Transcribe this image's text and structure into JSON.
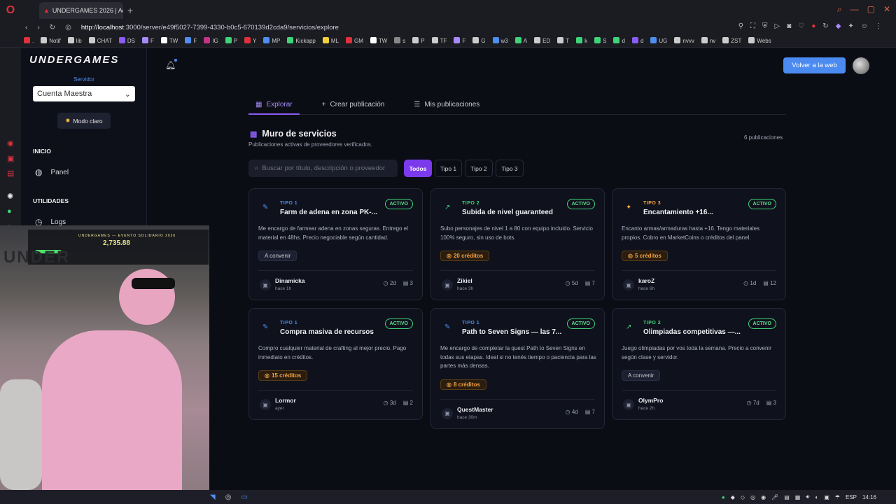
{
  "browser": {
    "tab_title": "UNDERGAMES 2026 | Acc",
    "url_host": "http://localhost",
    "url_rest": ":3000/server/e49f5027-7399-4330-b0c5-670139d2cda9/servicios/explore",
    "bookmarks": [
      ".",
      "Notif",
      "lib",
      "CHAT",
      "DS",
      "F",
      "TW",
      "F",
      "IG",
      "P",
      "Y",
      "MP",
      "Kickapp",
      "ML",
      "GM",
      "TW",
      "s",
      "P",
      "TF",
      "F",
      "G",
      "w3",
      "A",
      "ED",
      "T",
      "k",
      "S",
      "d",
      "d",
      "UG",
      "nvvv",
      "nv",
      "ZST",
      "Webs"
    ]
  },
  "sidebar": {
    "logo": "UNDERGAMES",
    "server_label": "Servidor",
    "server_value": "Cuenta Maestra",
    "theme_button": "Modo claro",
    "section_inicio": "INICIO",
    "item_panel": "Panel",
    "section_utilidades": "UTILIDADES",
    "item_logs": "Logs"
  },
  "header": {
    "back_button": "Volver a la web"
  },
  "tabs": {
    "explore": "Explorar",
    "create": "Crear publicación",
    "mine": "Mis publicaciones"
  },
  "wall": {
    "title": "Muro de servicios",
    "subtitle": "Publicaciones activas de proveedores verificados.",
    "count": "6 publicaciones",
    "search_placeholder": "Buscar por título, descripción o proveedor",
    "filters": [
      "Todos",
      "Tipo 1",
      "Tipo 2",
      "Tipo 3"
    ]
  },
  "cards": [
    {
      "tipo": "TIPO 1",
      "title": "Farm de adena en zona PK-...",
      "status": "ACTIVO",
      "desc": "Me encargo de farmear adena en zonas seguras. Entrego el material en 48hs. Precio negociable según cantidad.",
      "price": "A convenir",
      "user": "Dinamicka",
      "when": "hace 1h",
      "age": "2d",
      "comments": "3"
    },
    {
      "tipo": "TIPO 2",
      "title": "Subida de nivel guaranteed",
      "status": "ACTIVO",
      "desc": "Subo personajes de nivel 1 a 80 con equipo incluido. Servicio 100% seguro, sin uso de bots.",
      "price": "20 créditos",
      "user": "Zikiel",
      "when": "hace 3h",
      "age": "5d",
      "comments": "7"
    },
    {
      "tipo": "TIPO 3",
      "title": "Encantamiento +16...",
      "status": "ACTIVO",
      "desc": "Encanto armas/armaduras hasta +16. Tengo materiales propios. Cobro en MarketCoins o créditos del panel.",
      "price": "5 créditos",
      "user": "karoZ",
      "when": "hace 6h",
      "age": "1d",
      "comments": "12"
    },
    {
      "tipo": "TIPO 1",
      "title": "Compra masiva de recursos",
      "status": "ACTIVO",
      "desc": "Compro cualquier material de crafting al mejor precio. Pago inmediato en créditos.",
      "price": "15 créditos",
      "user": "Lormor",
      "when": "ayer",
      "age": "3d",
      "comments": "2"
    },
    {
      "tipo": "TIPO 1",
      "title": "Path to Seven Signs — las 7...",
      "status": "ACTIVO",
      "desc": "Me encargo de completar la quest Path to Seven Signs en todas sus etapas. Ideal si no tenés tiempo o paciencia para las partes más densas.",
      "price": "8 créditos",
      "user": "QuestMaster",
      "when": "hace 30m",
      "age": "4d",
      "comments": "7"
    },
    {
      "tipo": "TIPO 2",
      "title": "Olimpiadas competitivas —...",
      "status": "ACTIVO",
      "desc": "Juego olimpiadas por vos toda la semana. Precio a convenir según clase y servidor.",
      "price": "A convenir",
      "user": "OlymPro",
      "when": "hace 2h",
      "age": "7d",
      "comments": "3"
    }
  ],
  "webcam": {
    "banner_title": "UNDERGAMES — EVENTO SOLIDARIO 2026",
    "banner_amount": "2,735.88",
    "logo_text": "UNDER"
  },
  "taskbar": {
    "lang": "ESP",
    "time": "14:16"
  }
}
